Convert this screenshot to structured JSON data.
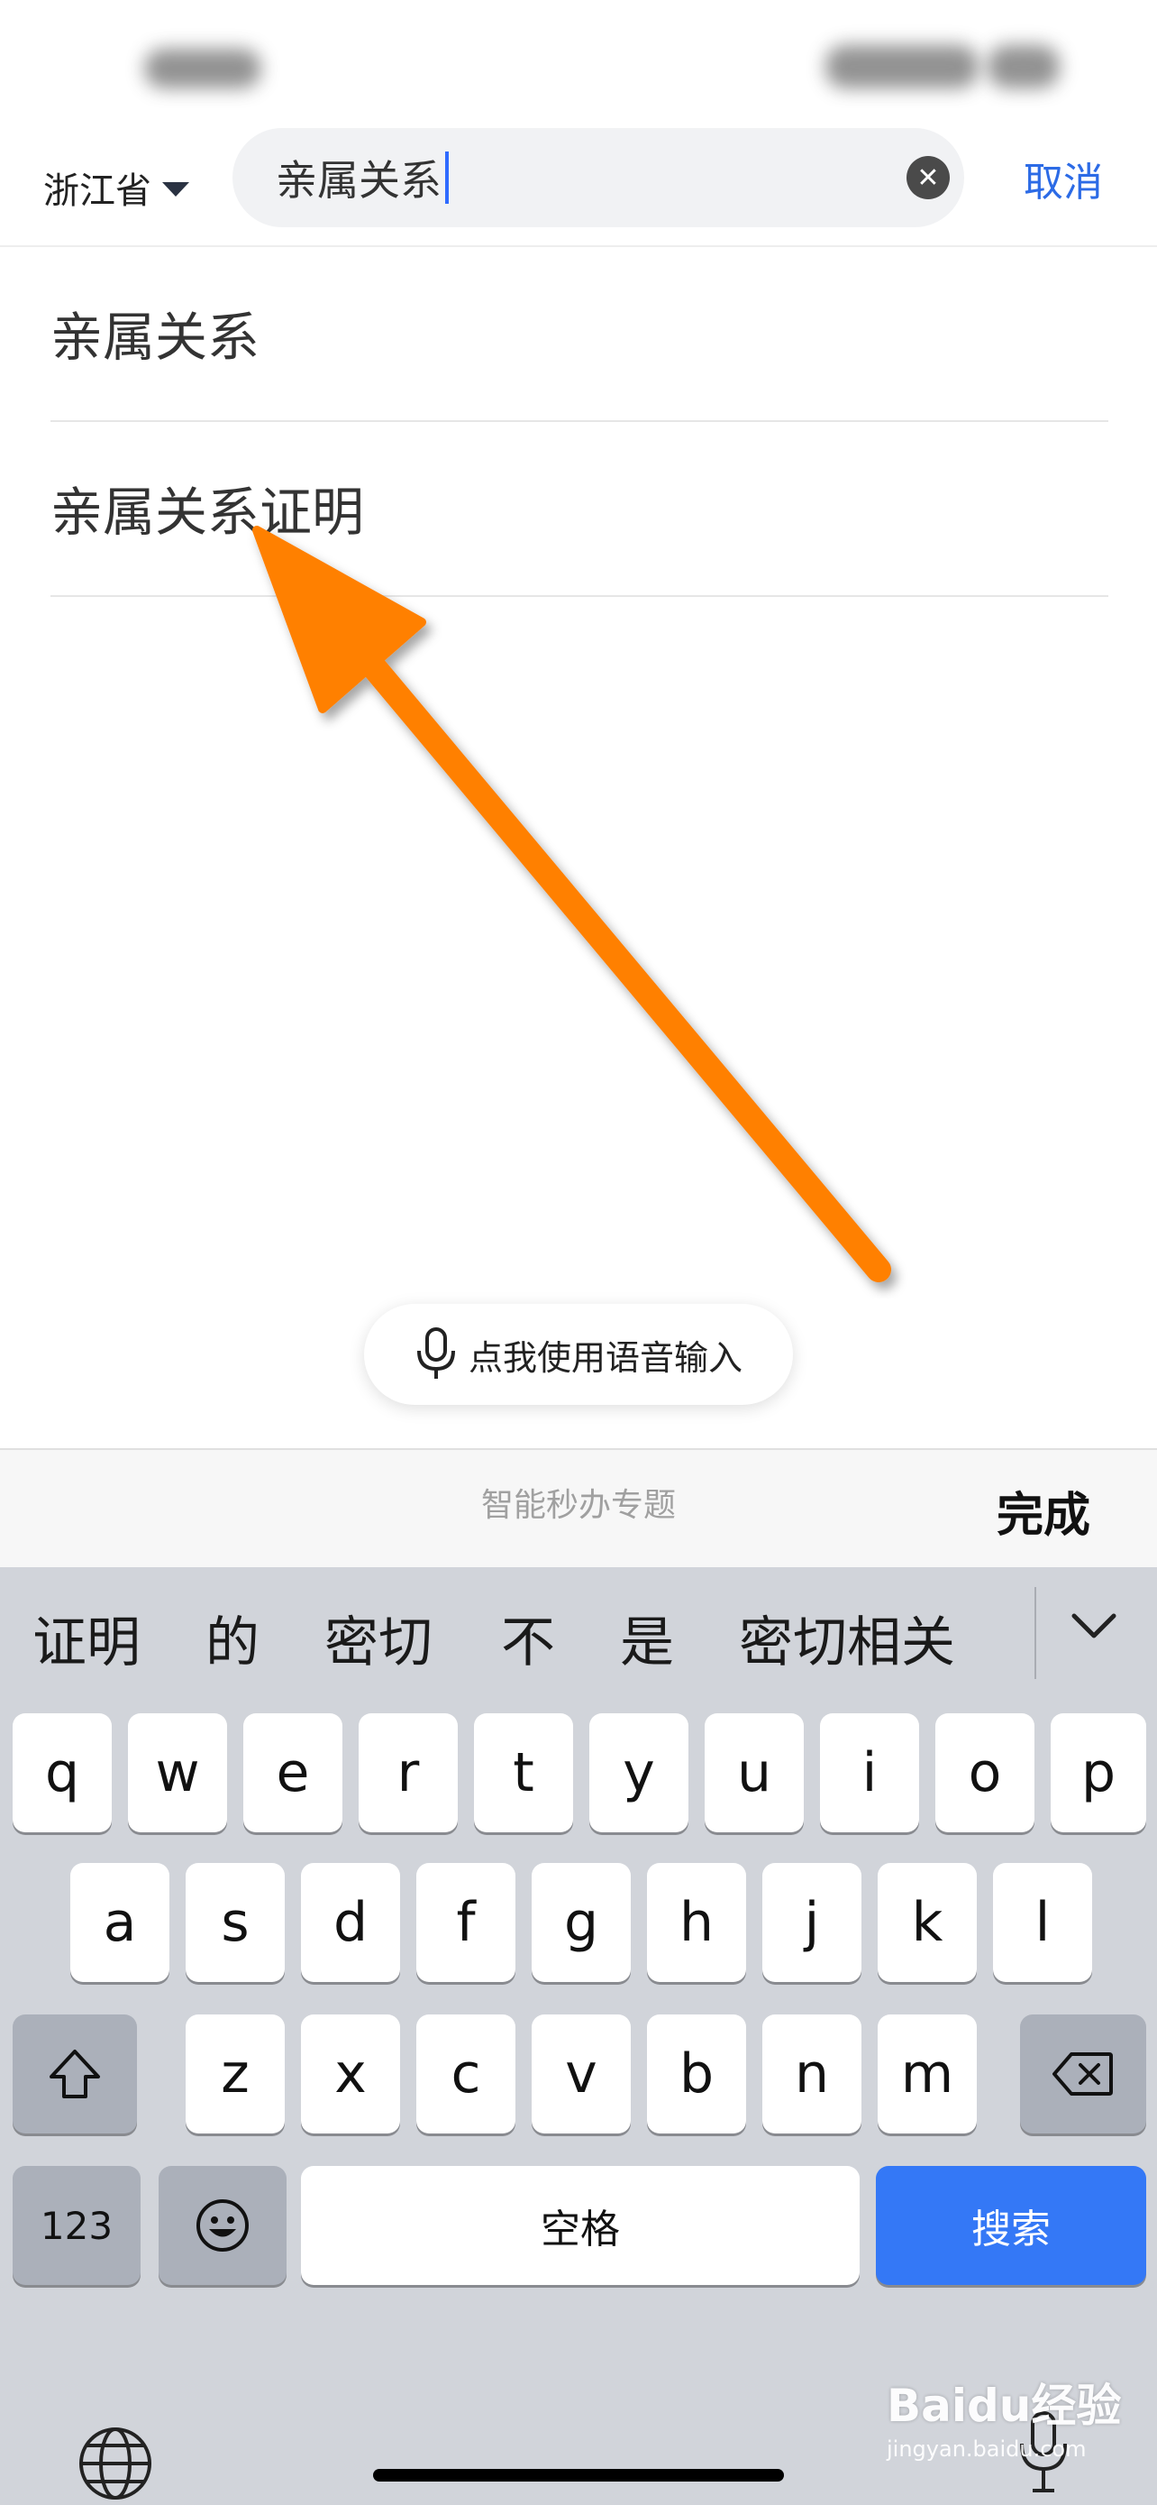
{
  "header": {
    "province": "浙江省",
    "search_value": "亲属关系",
    "cancel_label": "取消"
  },
  "suggestions": [
    {
      "label": "亲属关系"
    },
    {
      "label": "亲属关系证明"
    }
  ],
  "voice_button": {
    "label": "点我使用语音输入"
  },
  "accessory": {
    "center_label": "智能秒办专题",
    "done_label": "完成"
  },
  "keyboard": {
    "candidates": [
      "证明",
      "的",
      "密切",
      "不",
      "是",
      "密切相关"
    ],
    "row1": [
      "q",
      "w",
      "e",
      "r",
      "t",
      "y",
      "u",
      "i",
      "o",
      "p"
    ],
    "row2": [
      "a",
      "s",
      "d",
      "f",
      "g",
      "h",
      "j",
      "k",
      "l"
    ],
    "row3": [
      "z",
      "x",
      "c",
      "v",
      "b",
      "n",
      "m"
    ],
    "numbers_label": "123",
    "space_label": "空格",
    "search_label": "搜索"
  },
  "watermark": {
    "main": "Baidu经验",
    "sub": "jingyan.baidu.com"
  },
  "colors": {
    "accent": "#2c6be6",
    "search_key": "#3478f6",
    "arrow": "#ff8000"
  }
}
